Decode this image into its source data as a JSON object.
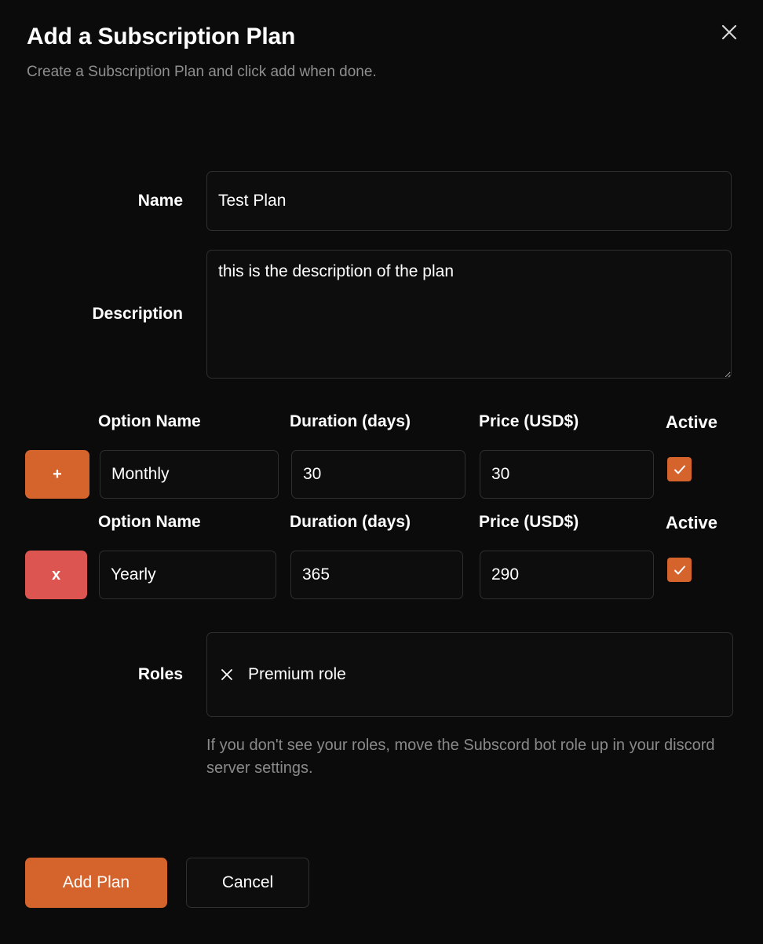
{
  "header": {
    "title": "Add a Subscription Plan",
    "subtitle": "Create a Subscription Plan and click add when done.",
    "close_icon": "close-icon"
  },
  "form": {
    "name": {
      "label": "Name",
      "value": "Test Plan",
      "placeholder": "Name"
    },
    "description": {
      "label": "Description",
      "value": "this is the description of the plan",
      "placeholder": "Description"
    },
    "option_headers": {
      "option_name": "Option Name",
      "duration": "Duration (days)",
      "price": "Price (USD$)",
      "active": "Active"
    },
    "options": [
      {
        "side_button_label": "+",
        "side_button_action": "add",
        "option_name": "Monthly",
        "duration": "30",
        "price": "30",
        "active": true,
        "check_icon": "check-icon"
      },
      {
        "side_button_label": "x",
        "side_button_action": "remove",
        "option_name": "Yearly",
        "duration": "365",
        "price": "290",
        "active": true,
        "check_icon": "check-icon"
      }
    ],
    "roles": {
      "label": "Roles",
      "selected": [
        {
          "name": "Premium role",
          "remove_icon": "close-icon"
        }
      ],
      "hint": "If you don't see your roles, move the Subscord bot role up in your discord server settings."
    }
  },
  "footer": {
    "submit_label": "Add Plan",
    "cancel_label": "Cancel"
  },
  "colors": {
    "accent_orange": "#d5632c",
    "danger_red": "#dd5550",
    "background": "#0b0b0b",
    "input_background": "#0d0d0d",
    "input_border": "#2f2f2f",
    "muted_text": "#8a8a8a"
  }
}
